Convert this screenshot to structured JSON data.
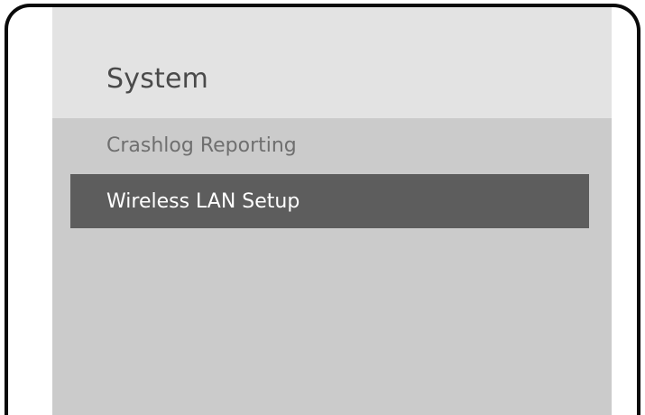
{
  "panel": {
    "title": "System",
    "items": [
      {
        "label": "Crashlog Reporting",
        "selected": false
      },
      {
        "label": "Wireless LAN Setup",
        "selected": true
      }
    ]
  },
  "colors": {
    "header_bg": "#e3e3e3",
    "panel_bg": "#cbcbcb",
    "selected_bg": "#5d5d5d",
    "selected_text": "#ffffff",
    "item_text": "#6f6f6f",
    "title_text": "#4a4a4a"
  }
}
